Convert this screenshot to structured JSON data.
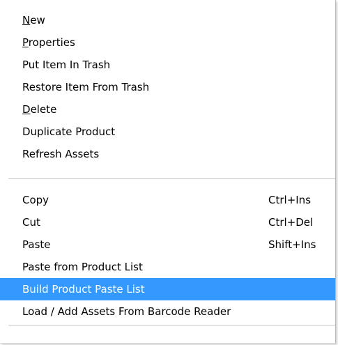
{
  "menu": {
    "group1": [
      {
        "label": "New",
        "mnemonic": "N"
      },
      {
        "label": "Properties",
        "mnemonic": "P"
      },
      {
        "label": "Put Item In Trash"
      },
      {
        "label": "Restore Item From Trash"
      },
      {
        "label": "Delete",
        "mnemonic": "D"
      },
      {
        "label": "Duplicate Product"
      },
      {
        "label": "Refresh Assets"
      }
    ],
    "group2": [
      {
        "label": "Copy",
        "shortcut": "Ctrl+Ins"
      },
      {
        "label": "Cut",
        "shortcut": "Ctrl+Del"
      },
      {
        "label": "Paste",
        "shortcut": "Shift+Ins"
      },
      {
        "label": "Paste from Product List"
      },
      {
        "label": "Build Product Paste List",
        "state": "highlighted"
      },
      {
        "label": "Load / Add Assets From Barcode Reader"
      }
    ]
  },
  "colors": {
    "highlight": "#3399ff",
    "highlight_text": "#ffffff",
    "text": "#000000",
    "separator": "#c8c8c8"
  }
}
